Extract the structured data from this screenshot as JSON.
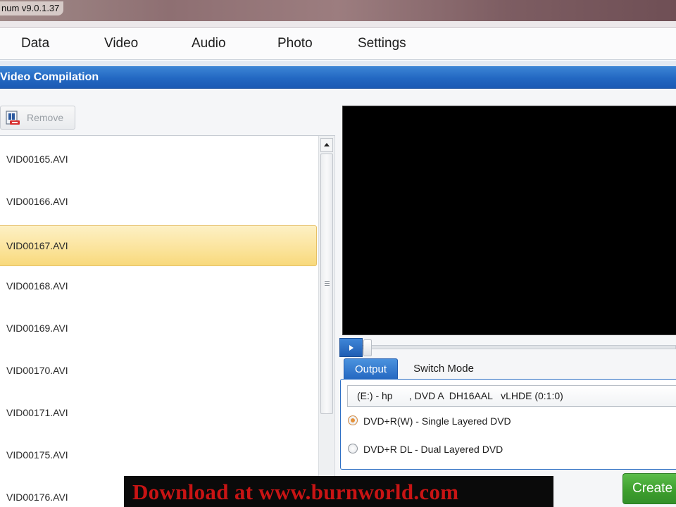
{
  "window": {
    "title": "num v9.0.1.37"
  },
  "menu": [
    "Data",
    "Video",
    "Audio",
    "Photo",
    "Settings"
  ],
  "section": {
    "title": "Video Compilation"
  },
  "toolbar": {
    "remove_label": "Remove"
  },
  "file_list": {
    "items": [
      "VID00165.AVI",
      "VID00166.AVI",
      "VID00167.AVI",
      "VID00168.AVI",
      "VID00169.AVI",
      "VID00170.AVI",
      "VID00171.AVI",
      "VID00175.AVI",
      "VID00176.AVI"
    ],
    "selected": "VID00167.AVI"
  },
  "output": {
    "tabs": [
      "Output",
      "Switch Mode"
    ],
    "active_tab": "Output",
    "drive": "(E:) - hp      , DVD A  DH16AAL   vLHDE (0:1:0)",
    "media_options": [
      "DVD+R(W) - Single Layered DVD",
      "DVD+R DL - Dual Layered DVD"
    ],
    "selected_media": "DVD+R(W) - Single Layered DVD"
  },
  "watermark": "Download at www.burnworld.com",
  "create_label": "Create",
  "colors": {
    "accent": "#2467c0",
    "selection": "#fbe39a",
    "create": "#3c9d2c",
    "watermark_text": "#c81414"
  }
}
